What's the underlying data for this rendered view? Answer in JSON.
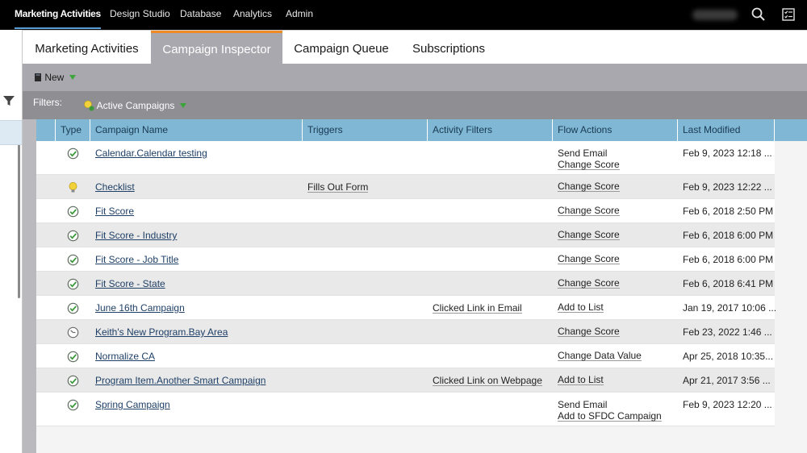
{
  "topnav": {
    "items": [
      {
        "label": "Marketing Activities",
        "active": true
      },
      {
        "label": "Design Studio",
        "active": false
      },
      {
        "label": "Database",
        "active": false
      },
      {
        "label": "Analytics",
        "active": false
      },
      {
        "label": "Admin",
        "active": false
      }
    ],
    "icons": [
      "search-icon",
      "checklist-icon"
    ]
  },
  "tabs": [
    {
      "label": "Marketing Activities",
      "active": false
    },
    {
      "label": "Campaign Inspector",
      "active": true
    },
    {
      "label": "Campaign Queue",
      "active": false
    },
    {
      "label": "Subscriptions",
      "active": false
    }
  ],
  "toolbar": {
    "new_label": "New",
    "new_icon": "new-document-icon"
  },
  "filters": {
    "label": "Filters:",
    "active_filter": "Active Campaigns",
    "icon": "lightbulb-icon"
  },
  "table": {
    "headers": [
      "Type",
      "Campaign Name",
      "Triggers",
      "Activity Filters",
      "Flow Actions",
      "Last Modified"
    ],
    "rows": [
      {
        "type": "batch-campaign-icon",
        "name": "Calendar.Calendar testing",
        "triggers": "",
        "activity_filters": "",
        "flow_actions": [
          "Send Email",
          "Change Score"
        ],
        "last_modified": "Feb 9, 2023 12:18 ..."
      },
      {
        "type": "trigger-campaign-icon",
        "name": "Checklist",
        "triggers": "Fills Out Form",
        "activity_filters": "",
        "flow_actions": [
          "Change Score"
        ],
        "last_modified": "Feb 9, 2023 12:22 ..."
      },
      {
        "type": "batch-campaign-icon",
        "name": "Fit Score",
        "triggers": "",
        "activity_filters": "",
        "flow_actions": [
          "Change Score"
        ],
        "last_modified": "Feb 6, 2018 2:50 PM"
      },
      {
        "type": "batch-campaign-icon",
        "name": "Fit Score - Industry",
        "triggers": "",
        "activity_filters": "",
        "flow_actions": [
          "Change Score"
        ],
        "last_modified": "Feb 6, 2018 6:00 PM"
      },
      {
        "type": "batch-campaign-icon",
        "name": "Fit Score - Job Title",
        "triggers": "",
        "activity_filters": "",
        "flow_actions": [
          "Change Score"
        ],
        "last_modified": "Feb 6, 2018 6:00 PM"
      },
      {
        "type": "batch-campaign-icon",
        "name": "Fit Score - State",
        "triggers": "",
        "activity_filters": "",
        "flow_actions": [
          "Change Score"
        ],
        "last_modified": "Feb 6, 2018 6:41 PM"
      },
      {
        "type": "batch-campaign-icon",
        "name": "June 16th Campaign",
        "triggers": "",
        "activity_filters": "Clicked Link in Email",
        "flow_actions": [
          "Add to List"
        ],
        "last_modified": "Jan 19, 2017 10:06 ..."
      },
      {
        "type": "scheduled-campaign-icon",
        "name": "Keith's New Program.Bay Area",
        "triggers": "",
        "activity_filters": "",
        "flow_actions": [
          "Change Score"
        ],
        "last_modified": "Feb 23, 2022 1:46 ..."
      },
      {
        "type": "batch-campaign-icon",
        "name": "Normalize CA",
        "triggers": "",
        "activity_filters": "",
        "flow_actions": [
          "Change Data Value"
        ],
        "last_modified": "Apr 25, 2018 10:35..."
      },
      {
        "type": "batch-campaign-icon",
        "name": "Program Item.Another Smart Campaign",
        "triggers": "",
        "activity_filters": "Clicked Link on Webpage",
        "flow_actions": [
          "Add to List"
        ],
        "last_modified": "Apr 21, 2017 3:56 ..."
      },
      {
        "type": "batch-campaign-icon",
        "name": "Spring Campaign",
        "triggers": "",
        "activity_filters": "",
        "flow_actions": [
          "Send Email",
          "Add to SFDC Campaign"
        ],
        "last_modified": "Feb 9, 2023 12:20 ..."
      }
    ]
  },
  "colors": {
    "topbar": "#000000",
    "active_tab_accent": "#f08a24",
    "header_blue": "#7fb7d5",
    "toolbar_gray": "#a8a8ae",
    "filterbar_gray": "#8e8e93"
  }
}
